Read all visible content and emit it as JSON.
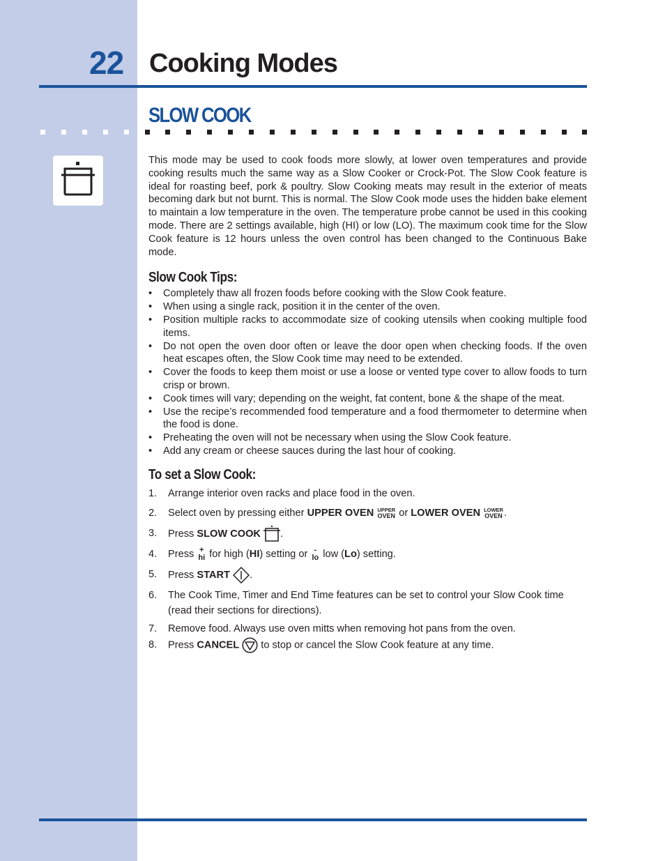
{
  "header": {
    "page_number": "22",
    "title": "Cooking Modes",
    "section_title": "SLOW COOK"
  },
  "colors": {
    "accent_blue": "#1a539a",
    "sidebar_bg": "#c3cde8",
    "text": "#231f20"
  },
  "mode_icon": "slow-cook-pot-icon",
  "intro": "This mode may be used to cook foods more slowly, at lower oven temperatures and provide cooking results much the same way as a Slow Cooker or Crock-Pot. The Slow Cook feature is ideal for roasting beef, pork & poultry. Slow Cooking meats may result in the exterior of meats becoming dark but not burnt. This is normal. The Slow Cook mode uses the hidden bake element to maintain a low  temperature in the oven. The temperature probe cannot be used in this cooking mode. There are 2 settings available, high (HI) or low (LO). The maximum cook time for the Slow Cook feature is 12 hours unless the oven control has been changed to the Continuous Bake mode.",
  "tips": {
    "heading": "Slow Cook Tips:",
    "items": [
      "Completely thaw all frozen foods before cooking with the Slow Cook feature.",
      "When using a single rack, position it in the center of the oven.",
      "Position multiple racks to accommodate size of cooking utensils when cooking multiple food items.",
      "Do not open the oven door often or leave the door open when checking foods. If the oven heat escapes often, the Slow Cook time may need to be extended.",
      "Cover the foods to keep them moist or use a loose or vented type cover to allow foods to turn crisp or brown.",
      "Cook times will vary; depending on the weight, fat content, bone & the shape of the meat.",
      "Use the recipe’s recommended food temperature and a food thermometer to determine when the food is done.",
      "Preheating the oven will not be necessary when using the Slow Cook feature.",
      "Add any cream or cheese sauces during the last hour of cooking."
    ]
  },
  "steps": {
    "heading": "To set a Slow Cook:",
    "s1": {
      "num": "1.",
      "text": "Arrange interior oven racks and place food in the oven."
    },
    "s2": {
      "num": "2.",
      "pre": "Select oven by pressing either ",
      "upper_label": "UPPER OVEN",
      "upper_key_top": "UPPER",
      "upper_key_bottom": "OVEN",
      "mid": " or ",
      "lower_label": "LOWER OVEN",
      "lower_key_top": "LOWER",
      "lower_key_bottom": "OVEN",
      "post": "."
    },
    "s3": {
      "num": "3.",
      "pre": "Press ",
      "label": "SLOW COOK",
      "post": "."
    },
    "s4": {
      "num": "4.",
      "pre": "Press ",
      "hi_top": "+",
      "hi_bottom": "hi",
      "mid1": " for high (",
      "hi_code": "HI",
      "mid2": ") setting or ",
      "lo_top": "-",
      "lo_bottom": "lo",
      "mid3": " low (",
      "lo_code": "Lo",
      "post": ") setting."
    },
    "s5": {
      "num": "5.",
      "pre": "Press ",
      "label": "START",
      "post": "."
    },
    "s6": {
      "num": "6.",
      "text": "The Cook Time, Timer and End Time features can be set to control your Slow Cook time (read their sections for directions)."
    },
    "s7": {
      "num": "7.",
      "text": "Remove food. Always use oven mitts when removing hot pans from the oven."
    },
    "s8": {
      "num": "8.",
      "pre": "Press ",
      "label": "CANCEL",
      "post": " to stop or cancel the Slow Cook feature at any time."
    }
  }
}
